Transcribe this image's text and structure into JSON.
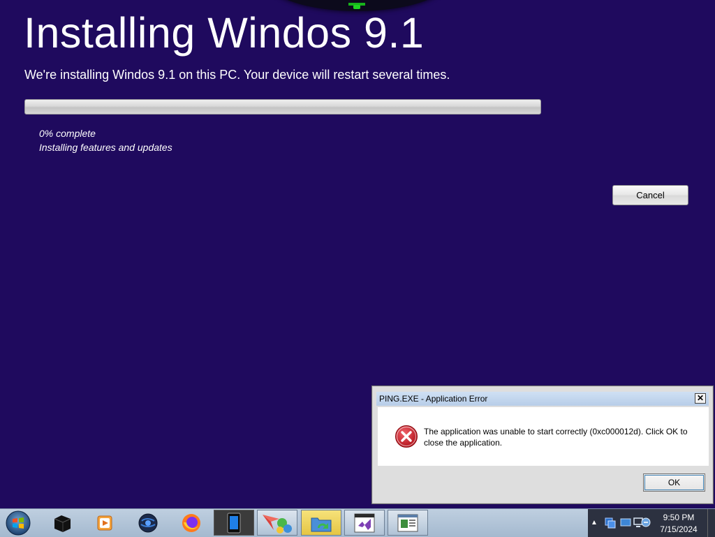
{
  "installer": {
    "title": "Installing Windos 9.1",
    "subtitle": "We're installing Windos 9.1 on this PC. Your device will restart several times.",
    "progress_percent": 0,
    "status_percent": "0% complete",
    "status_detail": "Installing features and updates",
    "cancel_label": "Cancel"
  },
  "error_dialog": {
    "title": "PING.EXE - Application Error",
    "close_glyph": "✕",
    "message": "The application was unable to start correctly (0xc000012d). Click OK to close the application.",
    "ok_label": "OK",
    "icon": "error-icon"
  },
  "taskbar": {
    "items": [
      {
        "name": "black-cube-app-icon",
        "state": "pinned"
      },
      {
        "name": "media-player-icon",
        "state": "pinned"
      },
      {
        "name": "globe-app-icon",
        "state": "pinned"
      },
      {
        "name": "firefox-icon",
        "state": "pinned"
      },
      {
        "name": "tablet-app-icon",
        "state": "running"
      },
      {
        "name": "network-app-icon",
        "state": "running"
      },
      {
        "name": "folder-refresh-icon",
        "state": "active"
      },
      {
        "name": "visual-studio-icon",
        "state": "running"
      },
      {
        "name": "document-window-icon",
        "state": "running"
      }
    ],
    "clock_time": "9:50 PM",
    "clock_date": "7/15/2024"
  },
  "colors": {
    "desktop_background": "#1f0a5e",
    "error_red": "#c4161c",
    "taskbar": "#a4b9cf"
  }
}
